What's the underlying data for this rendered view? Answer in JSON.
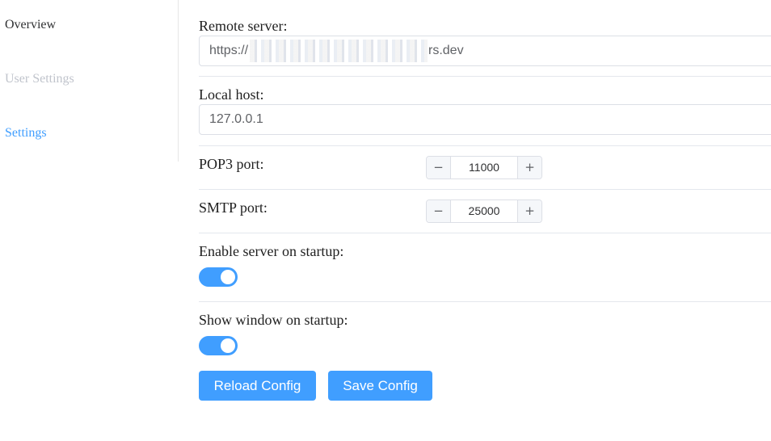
{
  "sidebar": {
    "items": [
      {
        "label": "Overview"
      },
      {
        "label": "User Settings"
      },
      {
        "label": "Settings"
      }
    ]
  },
  "form": {
    "remote_server": {
      "label": "Remote server:",
      "value_prefix": "https://",
      "value_suffix": "rs.dev"
    },
    "local_host": {
      "label": "Local host:",
      "value": "127.0.0.1"
    },
    "pop3_port": {
      "label": "POP3 port:",
      "value": "11000",
      "minus": "−",
      "plus": "+"
    },
    "smtp_port": {
      "label": "SMTP port:",
      "value": "25000",
      "minus": "−",
      "plus": "+"
    },
    "enable_server": {
      "label": "Enable server on startup:",
      "enabled": true
    },
    "show_window": {
      "label": "Show window on startup:",
      "enabled": true
    }
  },
  "actions": {
    "reload_label": "Reload Config",
    "save_label": "Save Config"
  },
  "colors": {
    "accent": "#409eff",
    "disabled_text": "#c0c4cc",
    "border": "#dcdfe6"
  }
}
